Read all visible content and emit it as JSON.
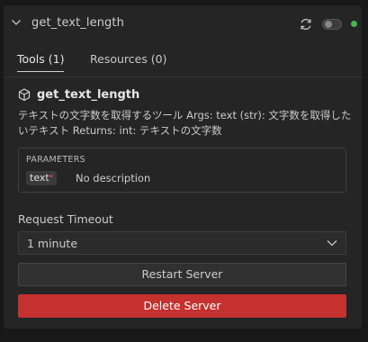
{
  "server": {
    "name": "get_text_length",
    "icons": {
      "collapse": "chevron-down-icon",
      "refresh": "refresh-icon"
    },
    "status_color": "#3fb950"
  },
  "tabs": [
    {
      "label": "Tools (1)",
      "active": true
    },
    {
      "label": "Resources (0)",
      "active": false
    }
  ],
  "tool": {
    "icon": "cube-icon",
    "name": "get_text_length",
    "description": "テキストの文字数を取得するツール Args: text (str): 文字数を取得したいテキスト Returns: int: テキストの文字数"
  },
  "parameters": {
    "title": "PARAMETERS",
    "items": [
      {
        "name": "text",
        "required_mark": "*",
        "description": "No description"
      }
    ]
  },
  "timeout": {
    "label": "Request Timeout",
    "value": "1 minute"
  },
  "actions": {
    "restart_label": "Restart Server",
    "delete_label": "Delete Server",
    "delete_color": "#c4312f"
  }
}
